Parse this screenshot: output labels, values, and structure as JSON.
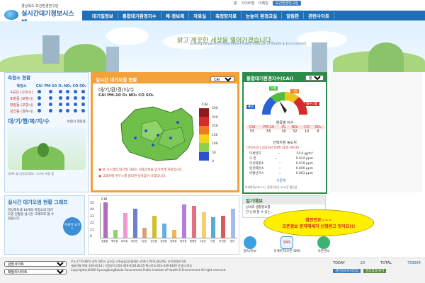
{
  "top_links": [
    "홈",
    "사이트맵",
    "이메일"
  ],
  "top_pill": "보건환경연구원",
  "logo": {
    "org": "경상북도 보건환경연구원",
    "name": "실시간대기정보시스템"
  },
  "nav": [
    "대기질정보",
    "통합대기환경지수",
    "예·경보제",
    "자료실",
    "측정망자료",
    "눈높이 환경교실",
    "알림판",
    "관련사이트"
  ],
  "banner": {
    "slogan": "맑고 깨끗한 세상을 열어가겠습니다.",
    "english": "GyeongSangBukdo Government Public Institute of Health & Environment"
  },
  "station": {
    "title": "측정소 현황",
    "columns": [
      "측정소",
      "CAI",
      "PM-10",
      "O₃",
      "NO₂",
      "CO",
      "SO₂"
    ],
    "rows": [
      "4공단 (구미시)",
      "포항동 (포항시)",
      "장량동 (포항시)",
      "성건동 (경주시)"
    ],
    "sub_title": "대/기/행/복/지/수",
    "sub_note": "보람시 정동동",
    "footnote": "(5/9) 실시간대기정보 / 노이즈 측정 중 "
  },
  "map_panel": {
    "title": "실시간 대기오염 현황",
    "select": "CAI",
    "legend_title": "대/기/환/경/지/수",
    "pollutants": "CAI PM-10 O₃ NO₂ CO SO₂",
    "scale_label": "CAI",
    "scale": [
      "500",
      "350",
      "250",
      "150",
      "100",
      "50",
      "0"
    ],
    "note1": "▣ 본 시스템의 대기질 자료는 최종선정을 받기전에 자료입니다.",
    "note2": "▣ 그래프에 마우스를 올리면 실측값이 나타납니다."
  },
  "cai_panel": {
    "title": "통합대기환경지수(CAI)",
    "select": "장량동",
    "gauge_labels": [
      "좋음",
      "보통",
      "나쁨",
      "매우나쁨"
    ],
    "table_title": "항목별 지수",
    "headers": [
      "CAI",
      "PM-10",
      "O₃",
      "NO₂",
      "CO",
      "SO₂"
    ],
    "values": [
      "55",
      "55",
      "30",
      "32",
      "10",
      "8"
    ],
    "concentration_title": "선택지점 농도치",
    "time": "(측정시간) 2014년 04월 30일 09:00",
    "items": [
      [
        "미세먼지",
        "--",
        "54.0 ㎍/m³"
      ],
      [
        "오 존",
        "--",
        "0.024 ppm"
      ],
      [
        "이산화질소",
        "--",
        "0.019 ppm"
      ],
      [
        "일산화탄소",
        "--",
        "0.400 ppm"
      ],
      [
        "아황산가스",
        "--",
        "0.003 ppm"
      ]
    ],
    "standard": "기준치",
    "footnote": "미세먼지(PM-10): 환경기준은 24시간 평균값"
  },
  "realtime": {
    "title": "실시간 대기오염 현황 그래프",
    "desc": "경상북도내 14개의 측정소의 대기오염 현황을 실시간 그래프로 볼 수 있습니다.",
    "btn": "자세히 보기 >"
  },
  "graph": {
    "ylabel": "CAI",
    "ticks": [
      "55",
      "44",
      "33",
      "22",
      "11",
      "0"
    ],
    "categories": [
      "동흥동",
      "죽도동",
      "대도동",
      "대송면",
      "3공단",
      "성건동",
      "장량동",
      "문화동",
      "형곡동",
      "원평동",
      "4공단",
      "안동",
      "포진동",
      "영천"
    ],
    "values": [
      55,
      12,
      38,
      45,
      15,
      34,
      22,
      12,
      52,
      50,
      40,
      32,
      34,
      45
    ],
    "colors": [
      "#b26bbf",
      "#8fd16b",
      "#f09ad0",
      "#6f7fd0",
      "#d7a37a",
      "#d0c030",
      "#64b0e0",
      "#f7b35a",
      "#b37de0",
      "#e27080",
      "#f2d070",
      "#5ca8d6",
      "#d95a5a",
      "#a6b9ea"
    ]
  },
  "weather": {
    "title": "일기예보",
    "line1": "날씨와 생활정보를",
    "line2": "한 눈에 볼 수 있는..."
  },
  "callout": {
    "line1": "잠깐만요~~~",
    "line2": "오존경보 문자메세지 신청받고 잇어요!!!"
  },
  "services": [
    "황사/독보",
    "미세먼지/오존 SMS",
    "오존경보"
  ],
  "counter": {
    "today_label": "TODAY",
    "today": "20",
    "total_label": "TOTAL",
    "total": "759564"
  },
  "footer": {
    "select1": "관련사이트",
    "select2": "패밀리사이트",
    "address": "주소:(770-805) 경북 영천시 금호읍 고주골길22(원제리 산58-17번지)경상북도 보건환경연구원",
    "phone": "대표전화:054-339-8114 | 민원창구:054-339-8104,8105 팩스번호:054-339-8109 운영자 메일",
    "copy": "Copyright(c)2006 GyeongSangBukdo Government Public Institute of Health & Environment All right reserved.",
    "btn1": "개인정보처리방침",
    "btn2": "영상회의/원격"
  }
}
